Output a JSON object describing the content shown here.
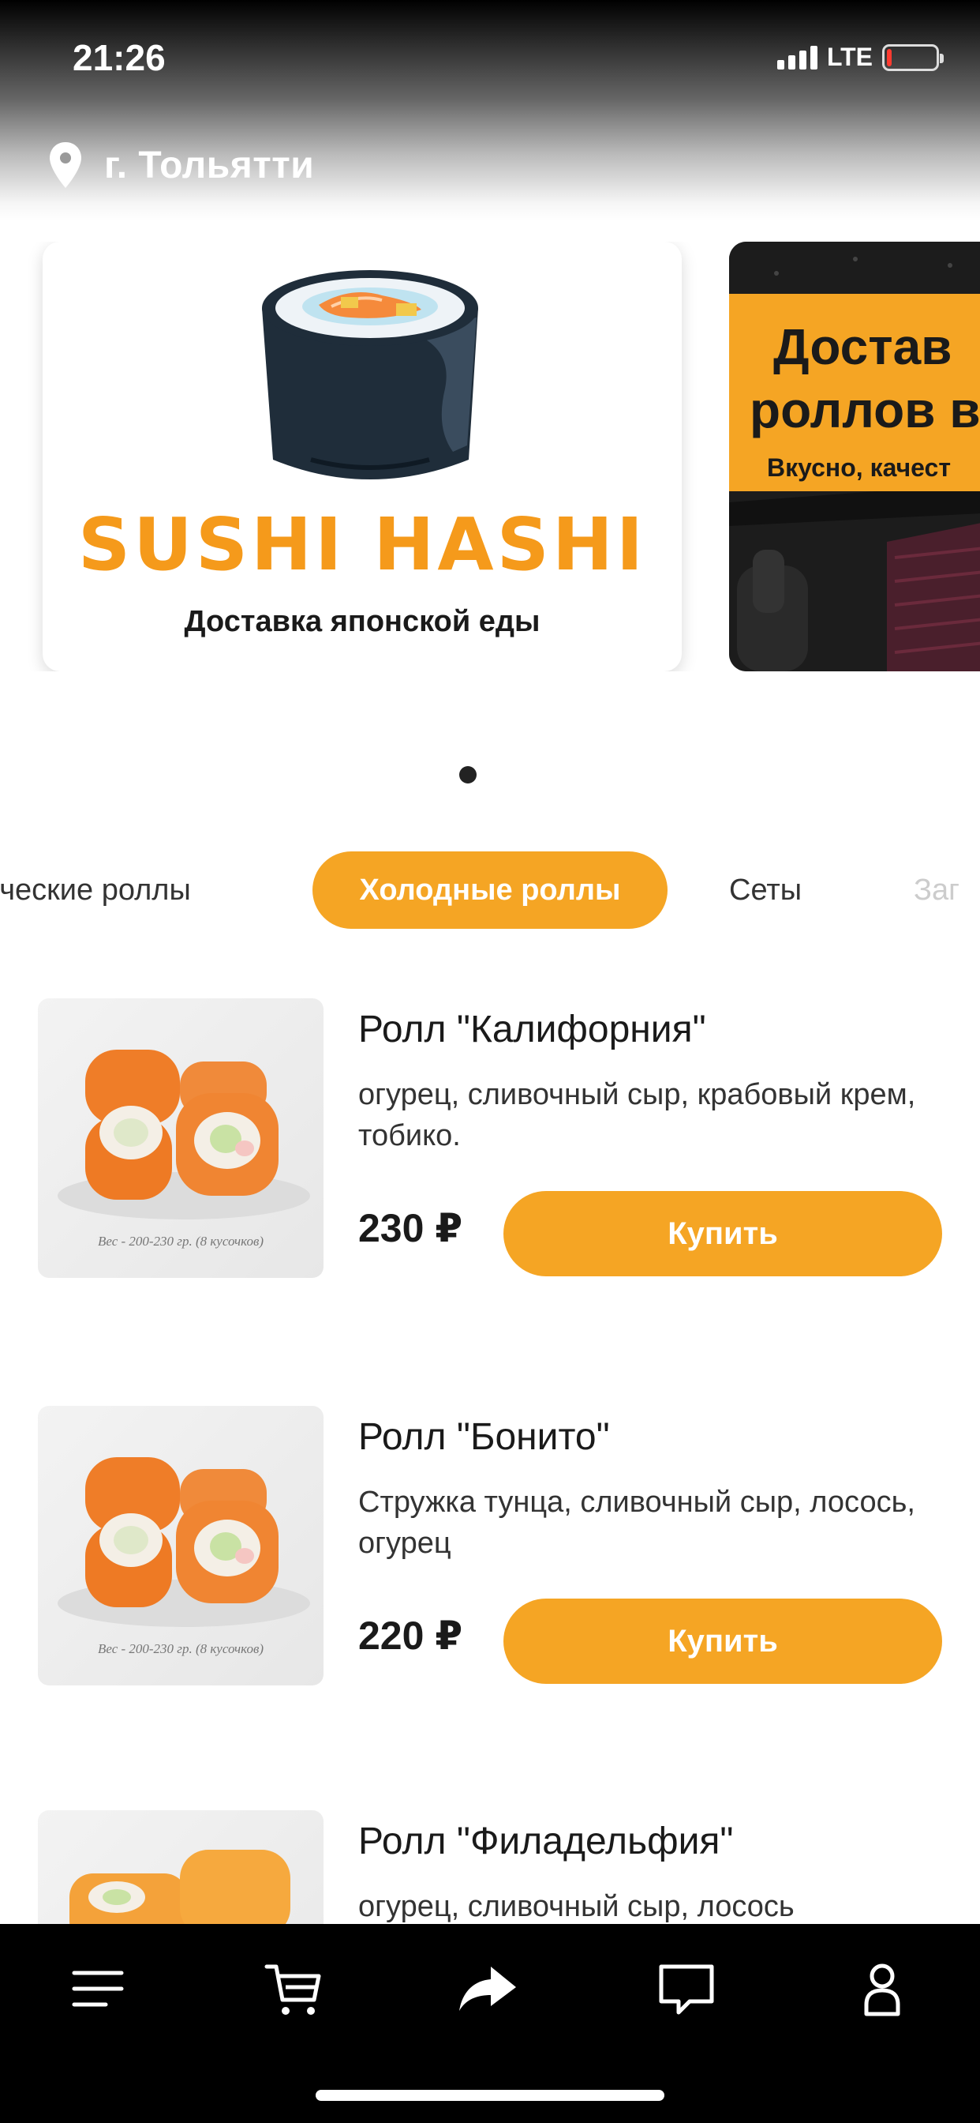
{
  "status_bar": {
    "time": "21:26",
    "network": "LTE",
    "battery_level": 0.1,
    "battery_color": "#ff3b30"
  },
  "header": {
    "location_icon": "location-pin-icon",
    "city": "г. Тольятти"
  },
  "banners": [
    {
      "brand_name": "SUSHI HASHI",
      "subtitle": "Доставка японской еды"
    },
    {
      "title_line1": "Достав",
      "title_line2": "роллов в",
      "subtitle": "Вкусно, качест"
    }
  ],
  "pager": {
    "active_index": 0
  },
  "categories": [
    {
      "label": "ические роллы",
      "active": false
    },
    {
      "label": "Холодные роллы",
      "active": true
    },
    {
      "label": "Сеты",
      "active": false
    },
    {
      "label": "Заг",
      "active": false
    }
  ],
  "products": [
    {
      "name": "Ролл \"Калифорния\"",
      "description": "огурец, сливочный сыр, крабовый крем, тобико.",
      "price": "230 ₽",
      "buy_label": "Купить",
      "image_caption": "Вес - 200-230 гр. (8 кусочков)"
    },
    {
      "name": "Ролл \"Бонито\"",
      "description": "Стружка тунца, сливочный сыр, лосось, огурец",
      "price": "220 ₽",
      "buy_label": "Купить",
      "image_caption": "Вес - 200-230 гр. (8 кусочков)"
    },
    {
      "name": "Ролл \"Филадельфия\"",
      "description": "огурец, сливочный сыр, лосось",
      "price": "",
      "buy_label": "",
      "image_caption": ""
    }
  ],
  "bottom_nav": {
    "items": [
      "menu-icon",
      "cart-icon",
      "share-icon",
      "chat-icon",
      "profile-icon"
    ]
  },
  "colors": {
    "accent": "#f5a524",
    "nav_background": "#000000",
    "brand_orange": "#f59a1b"
  }
}
